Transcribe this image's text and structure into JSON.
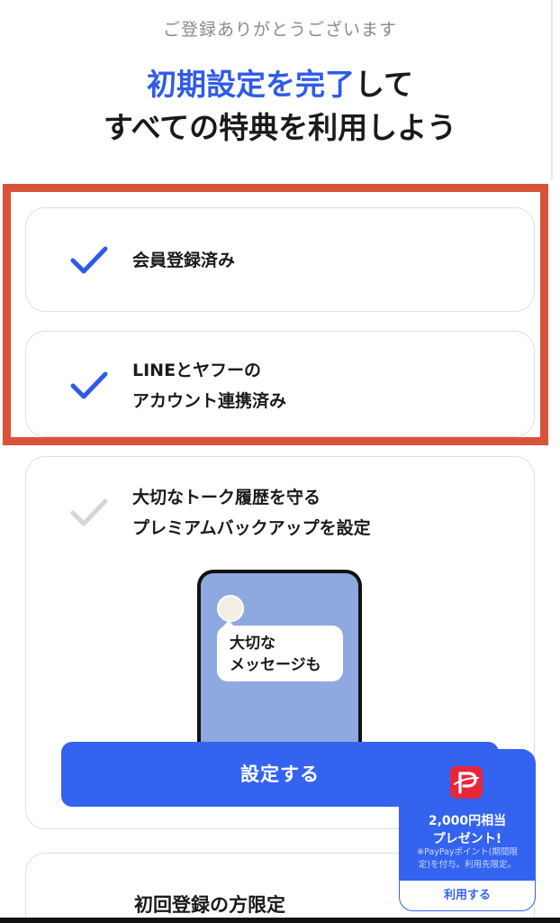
{
  "header": {
    "subtitle": "ご登録ありがとうございます",
    "headline_accent": "初期設定を完了",
    "headline_rest": "して",
    "headline_line2": "すべての特典を利用しよう"
  },
  "steps": [
    {
      "label": "会員登録済み",
      "completed": true
    },
    {
      "label_line1": "LINEとヤフーの",
      "label_line2": "アカウント連携済み",
      "completed": true
    },
    {
      "label_line1": "大切なトーク履歴を守る",
      "label_line2": "プレミアムバックアップを設定",
      "completed": false
    }
  ],
  "phone_illustration": {
    "bubble_line1": "大切な",
    "bubble_line2": "メッセージも"
  },
  "cta": {
    "label": "設定する"
  },
  "promo": {
    "amount_line1": "2,000円相当",
    "amount_line2": "プレゼント!",
    "note_line1": "※PayPayポイント(期間限",
    "note_line2": "定)を付与。利用先限定。",
    "link_label": "利用する"
  },
  "next_section": {
    "title": "初回登録の方限定"
  },
  "colors": {
    "accent": "#2f5bea",
    "button": "#3463f0",
    "highlight": "#d9533a",
    "check_done": "#2f5bea",
    "check_pending": "#d6d6da",
    "paypay_red": "#e8263a"
  }
}
